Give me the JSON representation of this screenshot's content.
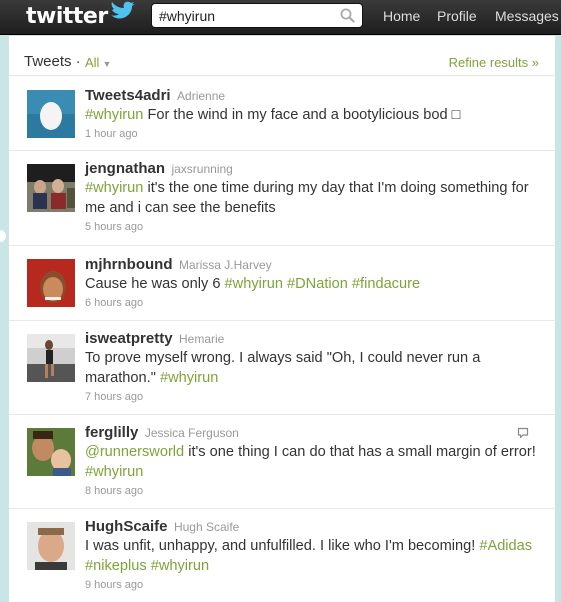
{
  "topbar": {
    "logo_text": "twitter",
    "search": {
      "value": "#whyirun",
      "placeholder": "Search"
    },
    "nav": [
      "Home",
      "Profile",
      "Messages"
    ]
  },
  "header": {
    "title": "Tweets ·",
    "filter": "All",
    "refine": "Refine results »"
  },
  "colors": {
    "accent": "#7fa33a",
    "topbar": "#262626",
    "background": "#c9e6e6"
  },
  "tweets": [
    {
      "username": "Tweets4adri",
      "realname": "Adrienne",
      "parts": [
        {
          "text": "#whyirun",
          "hl": true
        },
        {
          "text": " For the wind in my face and a bootylicious bod □",
          "hl": false
        }
      ],
      "time": "1 hour ago",
      "avatar": "egg-avatar"
    },
    {
      "username": "jengnathan",
      "realname": "jaxsrunning",
      "parts": [
        {
          "text": "#whyirun",
          "hl": true
        },
        {
          "text": " it's the one time during my day that I'm doing something for me and i can see the benefits",
          "hl": false
        }
      ],
      "time": "5 hours ago",
      "avatar": "group-photo-avatar"
    },
    {
      "username": "mjhrnbound",
      "realname": "Marissa J.Harvey",
      "parts": [
        {
          "text": "Cause he was only 6 ",
          "hl": false
        },
        {
          "text": "#whyirun",
          "hl": true
        },
        {
          "text": " ",
          "hl": false
        },
        {
          "text": "#DNation",
          "hl": true
        },
        {
          "text": " ",
          "hl": false
        },
        {
          "text": "#findacure",
          "hl": true
        }
      ],
      "time": "6 hours ago",
      "avatar": "portrait-avatar"
    },
    {
      "username": "isweatpretty",
      "realname": "Hemarie",
      "parts": [
        {
          "text": "To prove myself wrong. I always said \"Oh, I could never run a marathon.\" ",
          "hl": false
        },
        {
          "text": "#whyirun",
          "hl": true
        }
      ],
      "time": "7 hours ago",
      "avatar": "runner-avatar"
    },
    {
      "username": "ferglilly",
      "realname": "Jessica Ferguson",
      "parts": [
        {
          "text": "@runnersworld",
          "hl": true
        },
        {
          "text": " it's one thing I can do that has a small margin of error! ",
          "hl": false
        },
        {
          "text": "#whyirun",
          "hl": true
        }
      ],
      "time": "8 hours ago",
      "avatar": "mother-child-avatar",
      "reply_icon": "reply-icon"
    },
    {
      "username": "HughScaife",
      "realname": "Hugh Scaife",
      "parts": [
        {
          "text": "I was unfit, unhappy, and unfulfilled. I like who I'm becoming! ",
          "hl": false
        },
        {
          "text": "#Adidas",
          "hl": true
        },
        {
          "text": " ",
          "hl": false
        },
        {
          "text": "#nikeplus",
          "hl": true
        },
        {
          "text": " ",
          "hl": false
        },
        {
          "text": "#whyirun",
          "hl": true
        }
      ],
      "time": "9 hours ago",
      "avatar": "man-portrait-avatar"
    }
  ]
}
